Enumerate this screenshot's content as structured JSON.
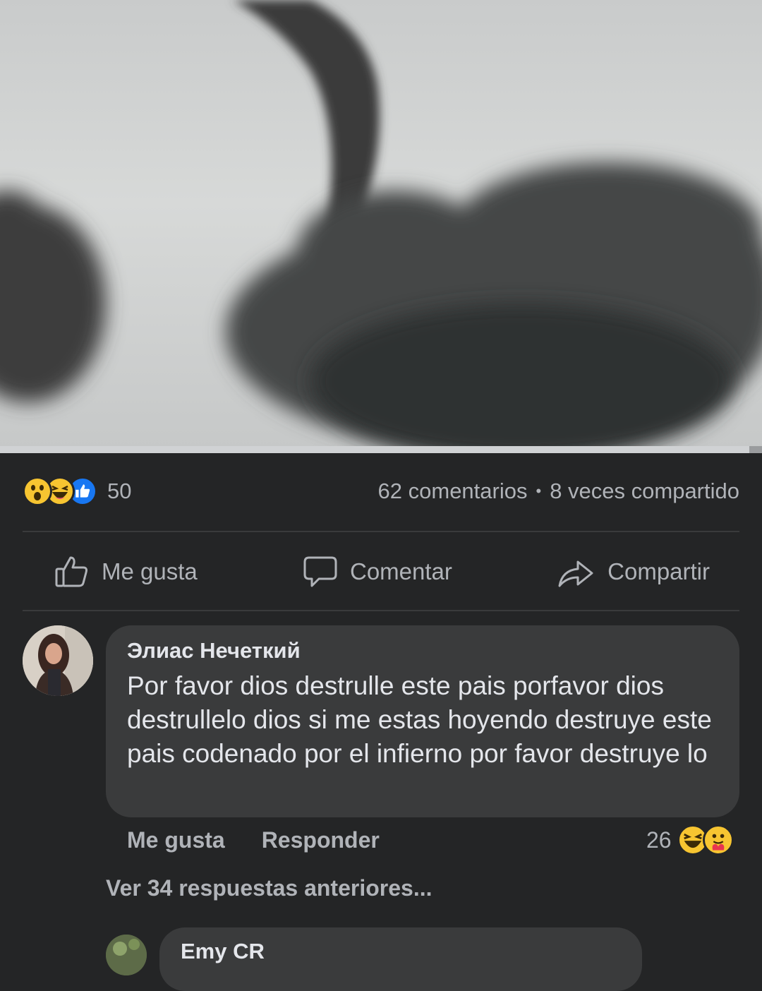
{
  "post": {
    "reactions": {
      "icons": [
        "wow-reaction-icon",
        "haha-reaction-icon",
        "like-reaction-icon"
      ],
      "count": "50"
    },
    "stats": {
      "comments": "62 comentarios",
      "separator": "•",
      "shares": "8 veces compartido"
    },
    "actions": {
      "like": "Me gusta",
      "comment": "Comentar",
      "share": "Compartir"
    }
  },
  "comment": {
    "author": "Элиас Нечеткий",
    "text": "Por favor dios destrulle este pais porfavor dios destrullelo dios si me estas hoyendo destruye este pais codenado por el infierno por favor destruye lo",
    "like_label": "Me gusta",
    "reply_label": "Responder",
    "reaction_count": "26",
    "reaction_icons": [
      "haha-reaction-icon",
      "care-reaction-icon"
    ]
  },
  "replies": {
    "more_label": "Ver 34 respuestas anteriores..."
  },
  "next_comment": {
    "author": "Emy CR"
  },
  "colors": {
    "background": "#242526",
    "bubble": "#3a3b3c",
    "primary_text": "#e4e6eb",
    "secondary_text": "#b0b3b8",
    "like_blue": "#1877f2",
    "reaction_yellow": "#f7c531"
  }
}
